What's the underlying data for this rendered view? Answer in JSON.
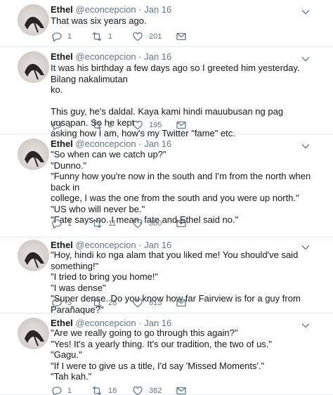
{
  "tweets": [
    {
      "name": "Ethel",
      "handle": "@econcepcion",
      "separator": "·",
      "date": "Jan 16",
      "text": "That was six years ago.",
      "replies": "1",
      "retweets": "1",
      "likes": "201"
    },
    {
      "name": "Ethel",
      "handle": "@econcepcion",
      "separator": "·",
      "date": "Jan 16",
      "text": "It was his birthday a few days ago so I greeted him yesterday. Bilang nakalimutan\nko.\n\nThis guy, he's daldal. Kaya kami hindi mauubusan ng pag uusapan. So he kept\nasking how I am, how's my Twitter \"fame\" etc.",
      "replies": "1",
      "retweets": "2",
      "likes": "195"
    },
    {
      "name": "Ethel",
      "handle": "@econcepcion",
      "separator": "·",
      "date": "Jan 16",
      "text": "\"So when can we catch up?\"\n\"Dunno.\"\n\"Funny how you're now in the south and I'm from the north when back in\ncollege, I was the one from the south and you were up north.\"\n\"US who will never be.\"\n\"Fate says no. I mean, fate and Ethel said no.\"",
      "replies": "1",
      "retweets": "11",
      "likes": "300"
    },
    {
      "name": "Ethel",
      "handle": "@econcepcion",
      "separator": "·",
      "date": "Jan 16",
      "text": "\"Hoy, hindi ko nga alam that you liked me! You should've said something!\"\n\"I tried to bring you home!\"\n\"I was dense\"\n\"Super dense. Do you know how far Fairview is for a guy from Parañaque?\"",
      "replies": "3",
      "retweets": "28",
      "likes": "613"
    },
    {
      "name": "Ethel",
      "handle": "@econcepcion",
      "separator": "·",
      "date": "Jan 16",
      "text": "\"Are we really going to go through this again?\"\n\"Yes! It's a yearly thing. It's our tradition, the two of us.\"\n\"Gagu.\"\n\"If I were to give us a title, I'd say 'Missed Moments'.\"\n\"Tah kah.\"",
      "replies": "1",
      "retweets": "16",
      "likes": "382"
    }
  ],
  "icons": {
    "reply": "reply-icon",
    "retweet": "retweet-icon",
    "like": "heart-icon",
    "message": "envelope-icon",
    "caret": "chevron-down-icon"
  },
  "colors": {
    "text": "#14171a",
    "muted": "#657786",
    "divider": "#e6ecf0"
  }
}
